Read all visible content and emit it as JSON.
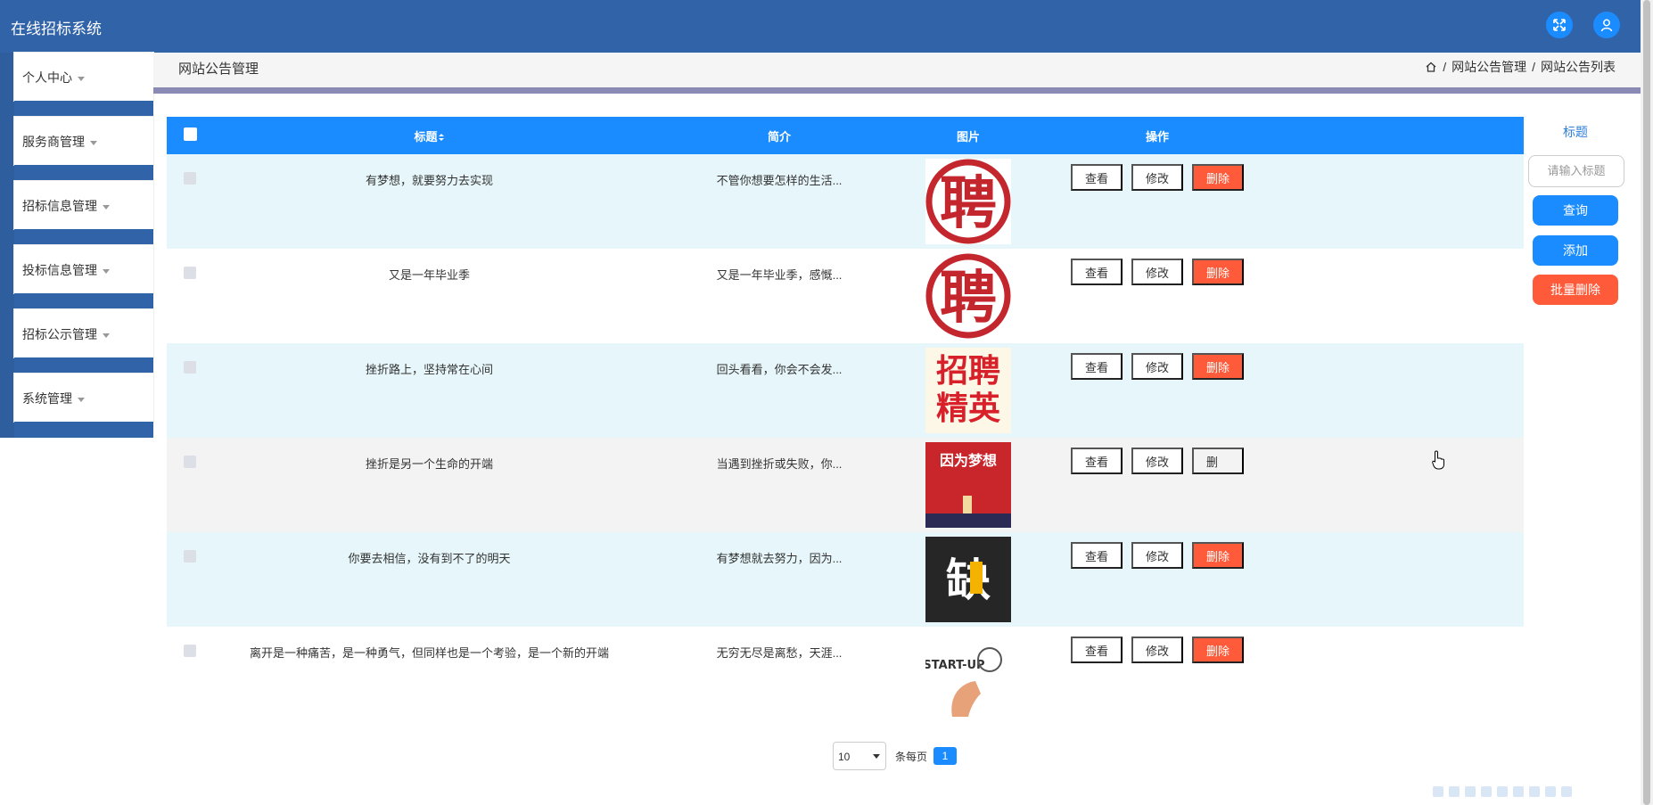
{
  "app": {
    "title": "在线招标系统"
  },
  "header": {
    "fullscreen_icon": "expand-icon",
    "user_icon": "user-icon"
  },
  "sidebar": {
    "items": [
      {
        "label": "个人中心"
      },
      {
        "label": "服务商管理"
      },
      {
        "label": "招标信息管理"
      },
      {
        "label": "投标信息管理"
      },
      {
        "label": "招标公示管理"
      },
      {
        "label": "系统管理"
      }
    ]
  },
  "page": {
    "title": "网站公告管理",
    "breadcrumb": [
      "网站公告管理",
      "网站公告列表"
    ],
    "separator": "/"
  },
  "table": {
    "columns": {
      "title": "标题",
      "intro": "简介",
      "image": "图片",
      "actions": "操作"
    },
    "rows": [
      {
        "title": "有梦想，就要努力去实现",
        "intro": "不管你想要怎样的生活...",
        "image": "聘"
      },
      {
        "title": "又是一年毕业季",
        "intro": "又是一年毕业季，感慨...",
        "image": "聘"
      },
      {
        "title": "挫折路上，坚持常在心间",
        "intro": "回头看看，你会不会发...",
        "image": "招聘精英"
      },
      {
        "title": "挫折是另一个生命的开端",
        "intro": "当遇到挫折或失败，你...",
        "image": "因为梦想"
      },
      {
        "title": "你要去相信，没有到不了的明天",
        "intro": "有梦想就去努力，因为...",
        "image": "缺"
      },
      {
        "title": "离开是一种痛苦，是一种勇气，但同样也是一个考验，是一个新的开端",
        "intro": "无穷无尽是离愁，天涯...",
        "image": "START-UP"
      }
    ],
    "actions": {
      "view": "查看",
      "edit": "修改",
      "delete": "删除",
      "delete_partial": "删"
    }
  },
  "search": {
    "label": "标题",
    "placeholder": "请输入标题",
    "query_label": "查询",
    "add_label": "添加",
    "batch_delete_label": "批量删除"
  },
  "pagination": {
    "page_size": "10",
    "per_page_text": "条每页",
    "current_page": "1"
  },
  "colors": {
    "topbar": "#3163a8",
    "accent": "#1a8cff",
    "danger": "#ff5b3a",
    "row_alt": "#e6f6fa"
  }
}
